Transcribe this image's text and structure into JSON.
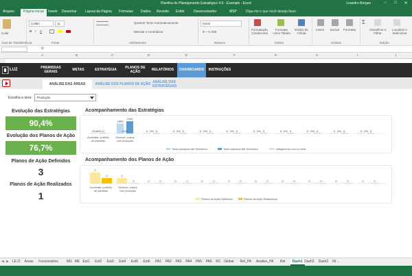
{
  "window": {
    "title": "Planilha de Planejamento Estratégico 4.0 - Exemplo - Excel",
    "user": "Leandro Borges",
    "controls": [
      "–",
      "□",
      "✕"
    ]
  },
  "ribbon_tabs": [
    "Arquivo",
    "Página Inicial",
    "Inserir",
    "Desenhar",
    "Layout da Página",
    "Fórmulas",
    "Dados",
    "Revisão",
    "Exibir",
    "Desenvolvedor",
    "MSP"
  ],
  "tell_me": "Diga-me o que você deseja fazer",
  "ribbon": {
    "paste": "Colar",
    "font_name": "Calibri",
    "font_size": "11",
    "wrap_text": "Quebrar Texto Automaticamente",
    "merge_center": "Mesclar e Centralizar",
    "number_format": "Geral",
    "cond_format": "Formatação Condicional",
    "format_table": "Formatar como Tabela",
    "cell_styles": "Estilos de Célula",
    "insert": "Inserir",
    "delete": "Excluir",
    "format": "Formatar",
    "sort_filter": "Classificar e Filtrar",
    "find_select": "Localizar e Selecionar",
    "groups": [
      "Área de Transferência",
      "Fonte",
      "Alinhamento",
      "Número",
      "Estilos",
      "Células",
      "Edição"
    ]
  },
  "formula_bar": {
    "fx": "fx"
  },
  "columns": [
    "A",
    "B",
    "C",
    "D",
    "E",
    "F",
    "G",
    "H",
    "I",
    "J"
  ],
  "nav": {
    "logo_text": "LUZ",
    "items": [
      "PREMISSAS GERAIS",
      "METAS",
      "ESTRATÉGIA",
      "PLANOS DE AÇÃO",
      "RELATÓRIOS",
      "DASHBOARDS",
      "INSTRUÇÕES"
    ],
    "active": "DASHBOARDS"
  },
  "subtabs": [
    "ANÁLISE DAS ÁREAS",
    "ANÁLISE DOS PLANOS DE AÇÃO",
    "ANÁLISE DAS ESTRATÉGIAS"
  ],
  "filter": {
    "label": "Escolha a área:",
    "value": "Produção"
  },
  "kpis": {
    "strategies_title": "Evolução das Estratégias",
    "strategies_value": "90,4%",
    "plans_title": "Evolução dos Planos de Ação",
    "plans_value": "76,7%",
    "defined_title": "Planos de Ação Definidos",
    "defined_value": "3",
    "done_title": "Planos de Ação Realizados",
    "done_value": "1"
  },
  "colors": {
    "excel_green": "#217346",
    "kpi_green": "#6ab04c",
    "nav_dark": "#2b2b2b",
    "nav_active": "#5b9bd5",
    "bar_light_blue": "#bdd7ee",
    "bar_blue": "#5b9bd5",
    "bar_light_yellow": "#ffe699",
    "bar_yellow": "#ffc000"
  },
  "chart_data": [
    {
      "type": "bar",
      "title": "Acompanhamento das Estratégias",
      "categories": [
        "Aumentar: portfólio de plantillas",
        "Diminuir: custos com produção",
        "",
        "",
        "",
        "",
        "",
        "",
        "",
        "",
        ""
      ],
      "series": [
        {
          "name": "Total planejado até Setembro",
          "values": [
            24,
            1800,
            0,
            0,
            0,
            0,
            0,
            0,
            0,
            0,
            0
          ]
        },
        {
          "name": "Total realizado até Setembro",
          "values": [
            21,
            2240,
            0,
            0,
            0,
            0,
            0,
            0,
            0,
            0,
            0
          ]
        },
        {
          "name": "Atingimento com a meta",
          "values": [
            88,
            93,
            0,
            0,
            0,
            0,
            0,
            0,
            0,
            0,
            0
          ]
        }
      ],
      "bar_labels": [
        [
          "24",
          "88%",
          "21"
        ],
        [
          "1800",
          "93%",
          "2240"
        ],
        [
          "0",
          "0%",
          "0"
        ],
        [
          "0",
          "0%",
          "0"
        ],
        [
          "0",
          "0%",
          "0"
        ],
        [
          "0",
          "0%",
          "0"
        ],
        [
          "0",
          "0%",
          "0"
        ],
        [
          "0",
          "0%",
          "0"
        ],
        [
          "0",
          "0%",
          "0"
        ],
        [
          "0",
          "0%",
          "0"
        ],
        [
          "0",
          "0%",
          "0"
        ]
      ],
      "legend": [
        "Total planejado até Setembro",
        "Total realizado até Setembro",
        "Atingimento com a meta"
      ]
    },
    {
      "type": "bar",
      "title": "Acompanhamento dos Planos de Ação",
      "categories": [
        "Aumentar: portfólio de plantillas",
        "Diminuir: custos com produção",
        "",
        "",
        "",
        "",
        "",
        "",
        "",
        "",
        ""
      ],
      "series": [
        {
          "name": "Planos de Ação Definidos",
          "values": [
            2,
            1,
            0,
            0,
            0,
            0,
            0,
            0,
            0,
            0,
            0
          ]
        },
        {
          "name": "Planos de Ação Realizados",
          "values": [
            1,
            0,
            0,
            0,
            0,
            0,
            0,
            0,
            0,
            0,
            0
          ]
        }
      ],
      "bar_labels": [
        [
          "2",
          "1"
        ],
        [
          "1",
          "0"
        ],
        [
          "0",
          "0"
        ],
        [
          "0",
          "0"
        ],
        [
          "0",
          "0"
        ],
        [
          "0",
          "0"
        ],
        [
          "0",
          "0"
        ],
        [
          "0",
          "0"
        ],
        [
          "0",
          "0"
        ],
        [
          "0",
          "0"
        ],
        [
          "0",
          "0"
        ]
      ],
      "legend": [
        "Planos de Ação Definidos",
        "Planos de Ação Realizados"
      ]
    }
  ],
  "sheet_tabs": [
    "LE.O",
    "Áreas",
    "Funcionários",
    "MG",
    "ME",
    "Est1",
    "Est2",
    "Est3",
    "Est4",
    "Est5",
    "Est6",
    "PA1",
    "PA2",
    "PA3",
    "PA4",
    "PA5",
    "PA6",
    "RC",
    "Global",
    "Rel_PA",
    "Analise_PA",
    "Rel",
    "Dash1",
    "Dash2",
    "Dash3",
    "IN ..."
  ],
  "active_sheet": "Dash1"
}
